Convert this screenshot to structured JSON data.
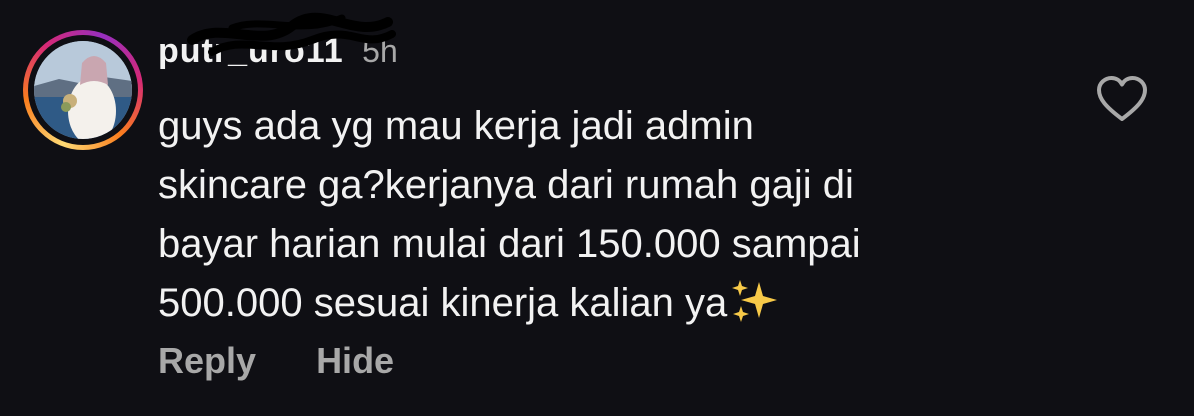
{
  "comment": {
    "username": "putr_uro11",
    "timestamp": "5h",
    "text_lines": [
      "guys ada yg mau kerja jadi admin",
      "skincare ga?kerjanya dari rumah gaji di",
      "bayar harian mulai dari 150.000 sampai",
      "500.000 sesuai kinerja kalian ya"
    ],
    "emoji": "sparkles-icon",
    "actions": {
      "reply": "Reply",
      "hide": "Hide"
    },
    "like_icon": "heart-outline-icon"
  },
  "colors": {
    "background": "#0f0f14",
    "text": "#f2f2f2",
    "muted": "#a8a8a8",
    "sparkle": "#f7c948"
  }
}
